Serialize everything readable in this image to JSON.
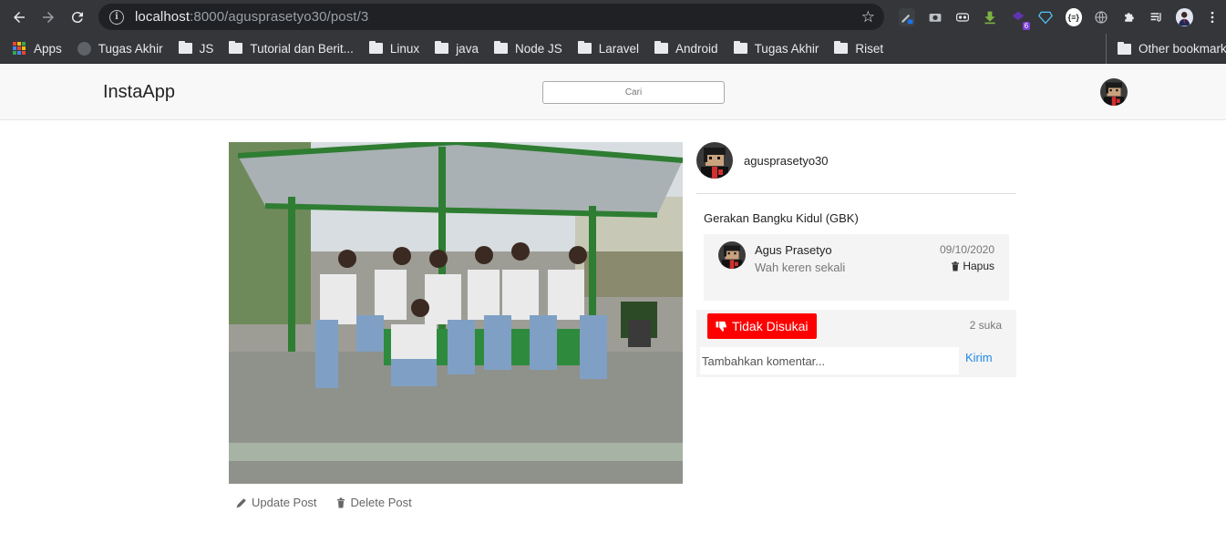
{
  "browser": {
    "url_host": "localhost",
    "url_path": ":8000/agusprasetyo30/post/3",
    "bookmarks": [
      "Apps",
      "Tugas Akhir",
      "JS",
      "Tutorial dan Berit...",
      "Linux",
      "java",
      "Node JS",
      "Laravel",
      "Android",
      "Tugas Akhir",
      "Riset"
    ],
    "other_bookmarks": "Other bookmarks",
    "extension_badge": "6",
    "extension_json_label": "{≡}"
  },
  "header": {
    "brand": "InstaApp",
    "search_placeholder": "Cari"
  },
  "post": {
    "author_username": "agusprasetyo30",
    "caption": "Gerakan Bangku Kidul (GBK)",
    "update_label": "Update Post",
    "delete_label": "Delete Post",
    "comments": [
      {
        "name": "Agus Prasetyo",
        "text": "Wah keren sekali",
        "date": "09/10/2020",
        "delete_label": "Hapus"
      }
    ],
    "unlike_label": "Tidak Disukai",
    "likes_count": "2 suka",
    "comment_placeholder": "Tambahkan komentar...",
    "send_label": "Kirim"
  },
  "colors": {
    "unlike_button": "#ff0000",
    "send_link": "#1e88e5",
    "chrome_bg": "#35363a"
  }
}
